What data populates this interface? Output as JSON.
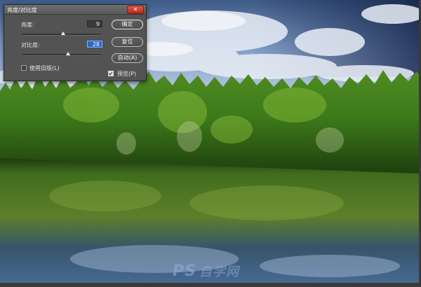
{
  "dialog": {
    "title": "亮度/对比度",
    "close_icon": "close-icon",
    "brightness": {
      "label": "亮度:",
      "value": "9",
      "level": 0.52
    },
    "contrast": {
      "label": "对比度:",
      "value": "28",
      "level": 0.58
    },
    "use_legacy": {
      "label": "使用旧版(L)",
      "checked": false
    },
    "preview": {
      "label": "预览(P)",
      "checked": true
    },
    "buttons": {
      "ok": "确定",
      "reset": "复位",
      "auto": "自动(A)"
    }
  },
  "watermark": {
    "brand": "PS",
    "sub": "自学网"
  },
  "colors": {
    "dialog_bg": "#535353",
    "active_input": "#2a68c8",
    "close_button": "#c8372a"
  }
}
